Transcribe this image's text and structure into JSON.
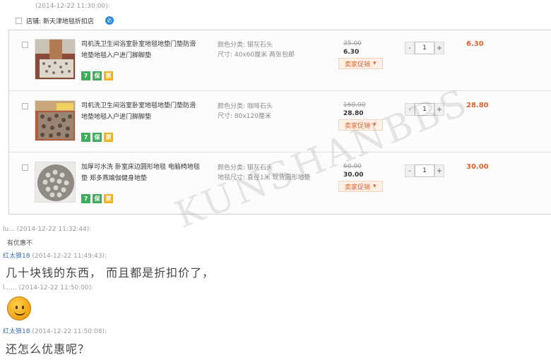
{
  "header": {
    "timestamp": "(2014-12-22 11:30:00):"
  },
  "shop": {
    "label": "店铺: 新天津地毯折扣店",
    "wangwang_icon": "chat-bubble-icon"
  },
  "items": [
    {
      "title": "司机洗卫生间浴室卧室地毯地垫门垫防滑地垫地毯入户进门脚脚垫",
      "color_prop": "颜色分类: 银灰石头",
      "size_prop": "尺寸: 40x60厘米 两张包邮",
      "old_price": "35.00",
      "new_price": "6.30",
      "promo_label": "卖家促销",
      "qty": "1",
      "total": "6.30"
    },
    {
      "title": "司机洗卫生间浴室卧室地毯地垫门垫防滑地垫地毯入户进门脚脚垫",
      "color_prop": "颜色分类: 咖啡石头",
      "size_prop": "尺寸: 80x120厘米",
      "old_price": "160.00",
      "new_price": "28.80",
      "promo_label": "卖家促销",
      "qty": "1",
      "total": "28.80"
    },
    {
      "title": "加厚可水洗 卧室床边圆形地毯 电脑椅地毯垫 郑多燕瑜伽健身地垫",
      "color_prop": "颜色分类: 银灰石头",
      "size_prop": "地毯尺寸: 直径1米 现货圆形地垫",
      "old_price": "60.00",
      "new_price": "30.00",
      "promo_label": "卖家促销",
      "qty": "1",
      "total": "30.00"
    }
  ],
  "qty_minus": "-",
  "qty_plus": "+",
  "badges": {
    "seven": "7",
    "shield": "保",
    "invoice": "票"
  },
  "chat": [
    {
      "user": "lu...",
      "time": "(2014-12-22 11:32:44):",
      "text": "有优惠不"
    },
    {
      "user": "红太狼18",
      "time": "(2014-12-22 11:49:43):",
      "text": "几十块钱的东西，   而且都是折扣价了，"
    },
    {
      "user": "l......",
      "time": "(2014-12-22 11:50:00):",
      "text": ""
    },
    {
      "user": "红太狼18",
      "time": "(2014-12-22 11:50:08):",
      "text": "还怎么优惠呢？"
    }
  ],
  "watermark": "KUNSHANBBS"
}
